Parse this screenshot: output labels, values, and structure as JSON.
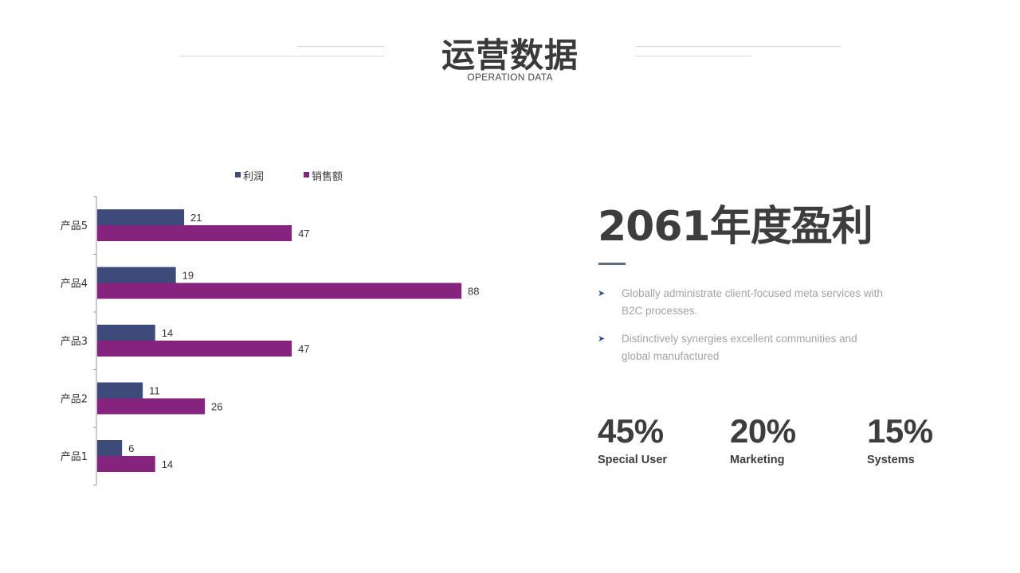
{
  "header": {
    "title": "运营数据",
    "subtitle": "OPERATION DATA"
  },
  "chart_data": {
    "type": "bar",
    "orientation": "horizontal",
    "categories": [
      "产品1",
      "产品2",
      "产品3",
      "产品4",
      "产品5"
    ],
    "series": [
      {
        "name": "利润",
        "color": "#3d4a7a",
        "values": [
          6,
          11,
          14,
          19,
          21
        ]
      },
      {
        "name": "销售额",
        "color": "#86237f",
        "values": [
          14,
          26,
          47,
          88,
          47
        ]
      }
    ],
    "title": "",
    "xlabel": "",
    "ylabel": "",
    "xlim": [
      0,
      88
    ],
    "grid": false,
    "legend": "top-center",
    "data_labels": true
  },
  "summary": {
    "headline": "2061年度盈利",
    "bullets": [
      "Globally administrate client-focused meta services with B2C processes.",
      "Distinctively synergies excellent communities and global manufactured"
    ],
    "bullet_icon": "arrow-right-icon",
    "accent_color": "#5f6b80"
  },
  "stats": [
    {
      "value": "45%",
      "label": "Special User"
    },
    {
      "value": "20%",
      "label": "Marketing"
    },
    {
      "value": "15%",
      "label": "Systems"
    }
  ]
}
